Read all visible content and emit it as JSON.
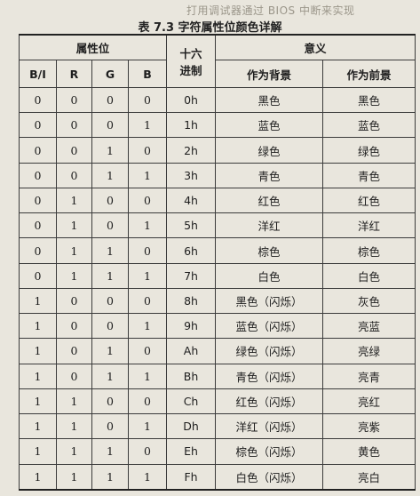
{
  "top_text": "打用调试器通过 BIOS 中断来实现",
  "caption": "表 7.3 字符属性位颜色详解",
  "headers": {
    "attr_bits": "属性位",
    "hex_line1": "十六",
    "hex_line2": "进制",
    "meaning": "意义",
    "bits": [
      "B/I",
      "R",
      "G",
      "B"
    ],
    "as_background": "作为背景",
    "as_foreground": "作为前景"
  },
  "rows": [
    {
      "bi": "0",
      "r": "0",
      "g": "0",
      "b": "0",
      "hex": "0h",
      "bg": "黑色",
      "fg": "黑色"
    },
    {
      "bi": "0",
      "r": "0",
      "g": "0",
      "b": "1",
      "hex": "1h",
      "bg": "蓝色",
      "fg": "蓝色"
    },
    {
      "bi": "0",
      "r": "0",
      "g": "1",
      "b": "0",
      "hex": "2h",
      "bg": "绿色",
      "fg": "绿色"
    },
    {
      "bi": "0",
      "r": "0",
      "g": "1",
      "b": "1",
      "hex": "3h",
      "bg": "青色",
      "fg": "青色"
    },
    {
      "bi": "0",
      "r": "1",
      "g": "0",
      "b": "0",
      "hex": "4h",
      "bg": "红色",
      "fg": "红色"
    },
    {
      "bi": "0",
      "r": "1",
      "g": "0",
      "b": "1",
      "hex": "5h",
      "bg": "洋红",
      "fg": "洋红"
    },
    {
      "bi": "0",
      "r": "1",
      "g": "1",
      "b": "0",
      "hex": "6h",
      "bg": "棕色",
      "fg": "棕色"
    },
    {
      "bi": "0",
      "r": "1",
      "g": "1",
      "b": "1",
      "hex": "7h",
      "bg": "白色",
      "fg": "白色"
    },
    {
      "bi": "1",
      "r": "0",
      "g": "0",
      "b": "0",
      "hex": "8h",
      "bg": "黑色（闪烁）",
      "fg": "灰色"
    },
    {
      "bi": "1",
      "r": "0",
      "g": "0",
      "b": "1",
      "hex": "9h",
      "bg": "蓝色（闪烁）",
      "fg": "亮蓝"
    },
    {
      "bi": "1",
      "r": "0",
      "g": "1",
      "b": "0",
      "hex": "Ah",
      "bg": "绿色（闪烁）",
      "fg": "亮绿"
    },
    {
      "bi": "1",
      "r": "0",
      "g": "1",
      "b": "1",
      "hex": "Bh",
      "bg": "青色（闪烁）",
      "fg": "亮青"
    },
    {
      "bi": "1",
      "r": "1",
      "g": "0",
      "b": "0",
      "hex": "Ch",
      "bg": "红色（闪烁）",
      "fg": "亮红"
    },
    {
      "bi": "1",
      "r": "1",
      "g": "0",
      "b": "1",
      "hex": "Dh",
      "bg": "洋红（闪烁）",
      "fg": "亮紫"
    },
    {
      "bi": "1",
      "r": "1",
      "g": "1",
      "b": "0",
      "hex": "Eh",
      "bg": "棕色（闪烁）",
      "fg": "黄色"
    },
    {
      "bi": "1",
      "r": "1",
      "g": "1",
      "b": "1",
      "hex": "Fh",
      "bg": "白色（闪烁）",
      "fg": "亮白"
    }
  ]
}
